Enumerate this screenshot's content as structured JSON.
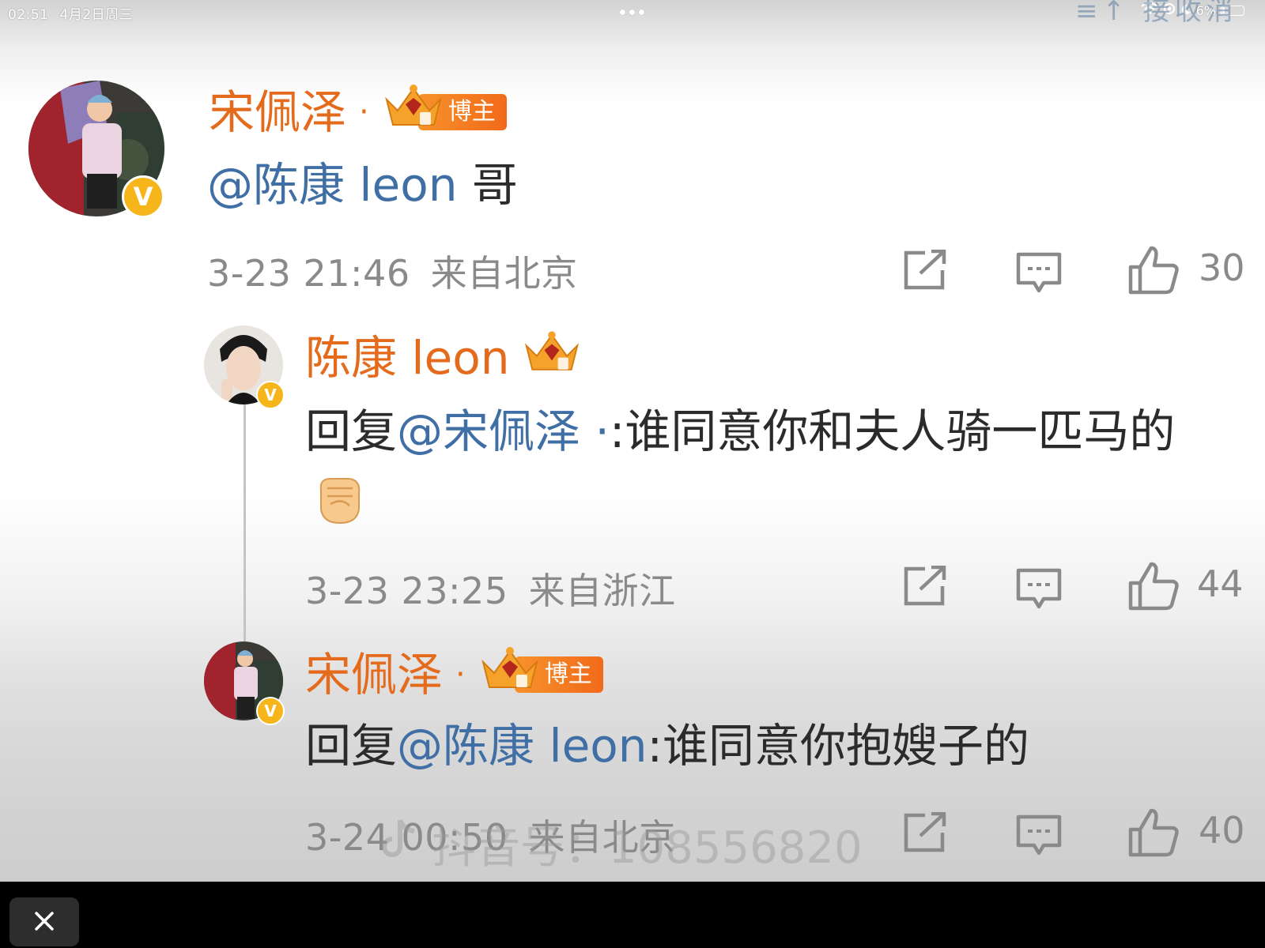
{
  "status_bar": {
    "time": "02:51",
    "date": "4月2日周三",
    "battery": "6%"
  },
  "comments": [
    {
      "name": "宋佩泽",
      "name_suffix": "·",
      "tag": "博主",
      "text_mention": "@陈康 leon",
      "text": " 哥",
      "datetime": "3-23 21:46",
      "location": "来自北京",
      "likes": "30"
    },
    {
      "name": "陈康 leon",
      "reply_prefix": "回复",
      "reply_mention": "@宋佩泽 ·",
      "text": ":谁同意你和夫人骑一匹马的",
      "datetime": "3-23 23:25",
      "location": "来自浙江",
      "likes": "44"
    },
    {
      "name": "宋佩泽",
      "name_suffix": "·",
      "tag": "博主",
      "reply_prefix": "回复",
      "reply_mention": "@陈康 leon",
      "text": ":谁同意你抱嫂子的",
      "datetime": "3-24 00:50",
      "location": "来自北京",
      "likes": "40"
    }
  ],
  "watermark": "抖音号：108556820",
  "colors": {
    "name_orange": "#e46a1c",
    "mention_blue": "#3f6fa5",
    "verified_gold": "#f6b51a"
  }
}
